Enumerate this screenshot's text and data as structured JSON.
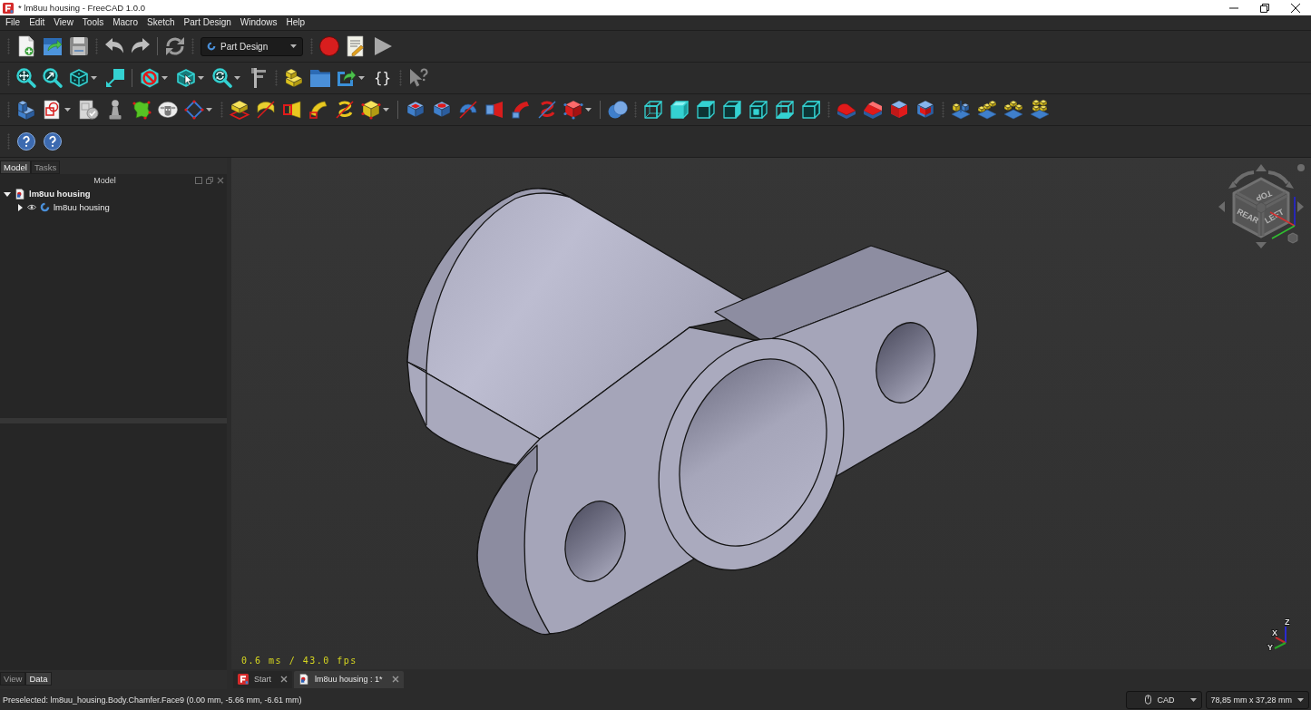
{
  "window": {
    "title": "* lm8uu housing - FreeCAD 1.0.0"
  },
  "menu_bar": [
    "File",
    "Edit",
    "View",
    "Tools",
    "Macro",
    "Sketch",
    "Part Design",
    "Windows",
    "Help"
  ],
  "toolbars": {
    "workbench": "Part Design",
    "variable_set": "{}"
  },
  "combo_view": {
    "tabs": [
      {
        "label": "Model",
        "selected": true
      },
      {
        "label": "Tasks",
        "selected": false
      }
    ],
    "title": "Model",
    "tree": [
      {
        "label": "lm8uu housing",
        "kind": "document",
        "expanded": true,
        "children": [
          {
            "label": "lm8uu housing",
            "kind": "body",
            "expanded": false
          }
        ]
      }
    ],
    "property_tabs": [
      {
        "label": "View",
        "selected": false
      },
      {
        "label": "Data",
        "selected": true
      }
    ]
  },
  "viewport": {
    "fps": "0.6 ms / 43.0 fps",
    "navigation_cube": {
      "faces": [
        {
          "label": "TOP",
          "kind": "top"
        },
        {
          "label": "REAR",
          "kind": "left"
        },
        {
          "label": "LEFT",
          "kind": "right"
        }
      ]
    },
    "axis_labels": [
      "Z",
      "X",
      "Y"
    ]
  },
  "document_tabs": [
    {
      "label": "Start",
      "kind": "start",
      "selected": false
    },
    {
      "label": "lm8uu housing : 1*",
      "kind": "document",
      "selected": true
    }
  ],
  "status_bar": {
    "message": "Preselected: lm8uu_housing.Body.Chamfer.Face9 (0.00 mm, -5.66 mm, -6.61 mm)",
    "navigation_style": "CAD",
    "dimensions": "78,85 mm x 37,28 mm"
  }
}
